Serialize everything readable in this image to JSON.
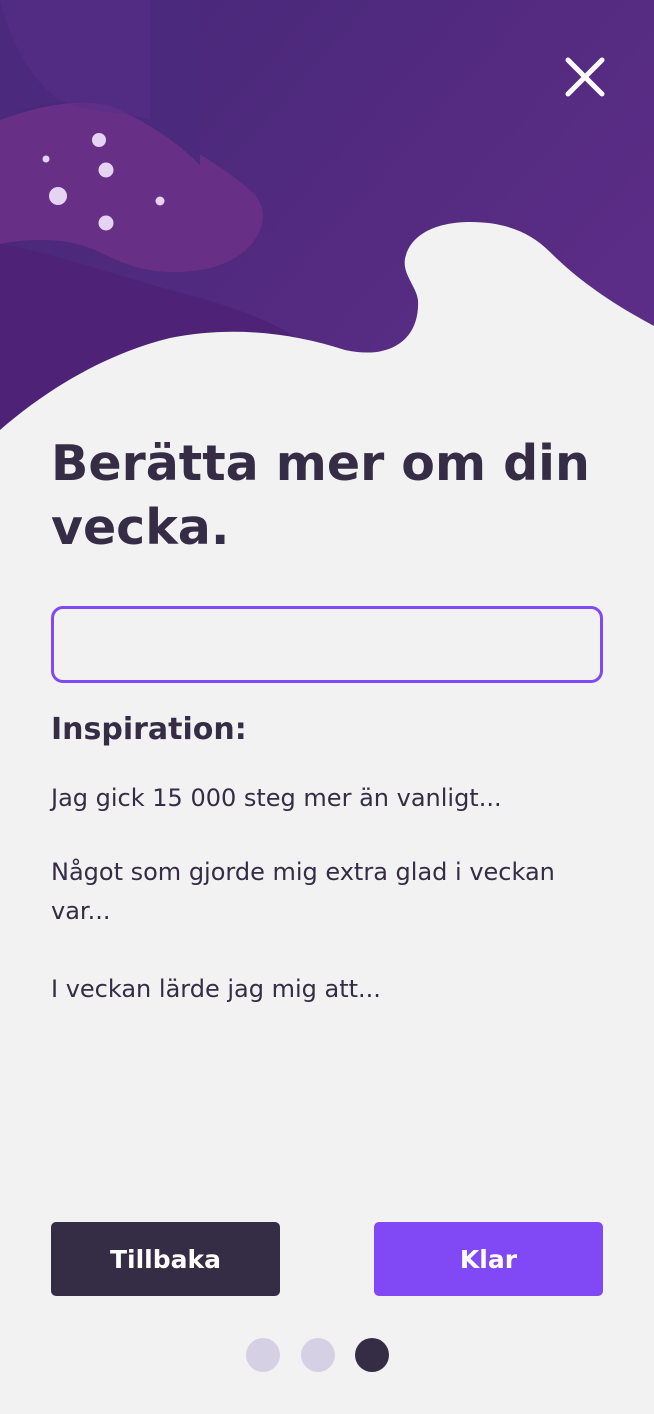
{
  "header": {
    "close_icon": "close-icon"
  },
  "main": {
    "title": "Berätta mer om din vecka.",
    "input": {
      "value": "",
      "placeholder": ""
    },
    "inspiration_heading": "Inspiration:",
    "prompts": [
      "Jag gick 15 000 steg mer än vanligt...",
      "Något som gjorde mig extra glad i veckan var...",
      "I veckan lärde jag mig att..."
    ]
  },
  "footer": {
    "back_label": "Tillbaka",
    "done_label": "Klar",
    "pagination": {
      "total": 3,
      "current": 3
    }
  },
  "colors": {
    "accent": "#8148f5",
    "dark": "#352d45",
    "background": "#f2f2f2",
    "hero_purple": "#4e2c7d",
    "dot_inactive": "#d6d0e4"
  }
}
